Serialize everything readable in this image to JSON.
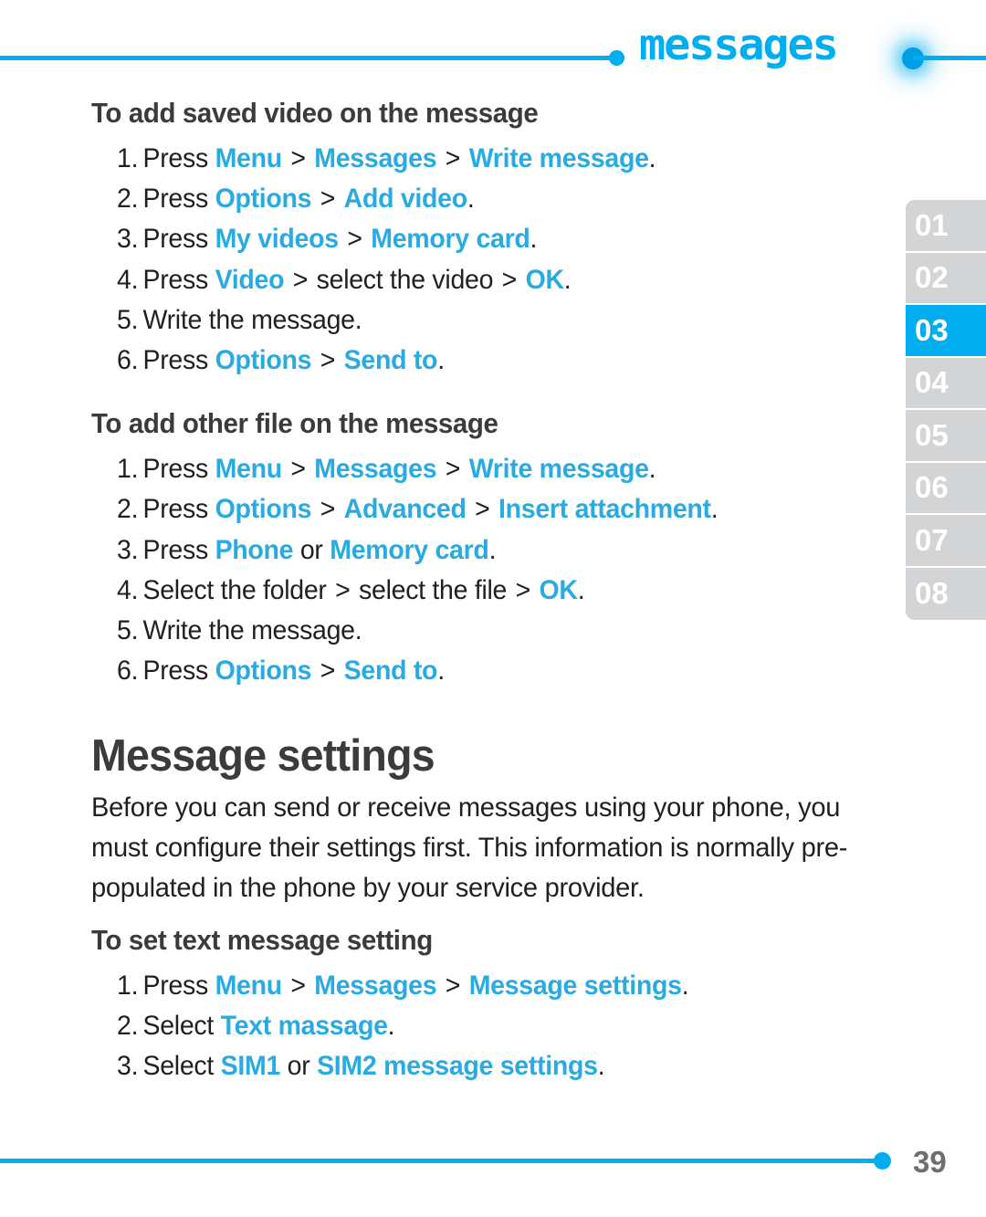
{
  "header": {
    "title": "messages",
    "left_dot": "bullet-dot",
    "right_dot": "bullet-dot-glow",
    "accent_color": "#00AEEF"
  },
  "sidebar": {
    "active_index": 2,
    "active_color": "#00AEEF",
    "inactive_color": "#D2D4D5",
    "tabs": [
      {
        "label": "01"
      },
      {
        "label": "02"
      },
      {
        "label": "03"
      },
      {
        "label": "04"
      },
      {
        "label": "05"
      },
      {
        "label": "06"
      },
      {
        "label": "07"
      },
      {
        "label": "08"
      }
    ]
  },
  "content": {
    "link_color": "#29ABE2",
    "sections": [
      {
        "heading": "To add saved video on the message",
        "steps": [
          {
            "num": "1.",
            "parts": [
              {
                "t": "Press ",
                "k": "plain"
              },
              {
                "t": "Menu",
                "k": "link"
              },
              {
                "t": " > ",
                "k": "sep"
              },
              {
                "t": "Messages",
                "k": "link"
              },
              {
                "t": " > ",
                "k": "sep"
              },
              {
                "t": "Write message",
                "k": "link"
              },
              {
                "t": ".",
                "k": "plain"
              }
            ]
          },
          {
            "num": "2.",
            "parts": [
              {
                "t": "Press ",
                "k": "plain"
              },
              {
                "t": "Options",
                "k": "link"
              },
              {
                "t": " > ",
                "k": "sep"
              },
              {
                "t": "Add video",
                "k": "link"
              },
              {
                "t": ".",
                "k": "plain"
              }
            ]
          },
          {
            "num": "3.",
            "parts": [
              {
                "t": "Press ",
                "k": "plain"
              },
              {
                "t": "My videos",
                "k": "link"
              },
              {
                "t": " > ",
                "k": "sep"
              },
              {
                "t": "Memory card",
                "k": "link"
              },
              {
                "t": ".",
                "k": "plain"
              }
            ]
          },
          {
            "num": "4.",
            "parts": [
              {
                "t": "Press ",
                "k": "plain"
              },
              {
                "t": "Video",
                "k": "link"
              },
              {
                "t": " > ",
                "k": "sep"
              },
              {
                "t": "select the video",
                "k": "plain"
              },
              {
                "t": " > ",
                "k": "sep"
              },
              {
                "t": "OK",
                "k": "link"
              },
              {
                "t": ".",
                "k": "plain"
              }
            ]
          },
          {
            "num": "5.",
            "parts": [
              {
                "t": "Write the message.",
                "k": "plain"
              }
            ]
          },
          {
            "num": "6.",
            "parts": [
              {
                "t": "Press ",
                "k": "plain"
              },
              {
                "t": "Options",
                "k": "link"
              },
              {
                "t": " > ",
                "k": "sep"
              },
              {
                "t": "Send to",
                "k": "link"
              },
              {
                "t": ".",
                "k": "plain"
              }
            ]
          }
        ]
      },
      {
        "heading": "To add other file on the message",
        "steps": [
          {
            "num": "1.",
            "parts": [
              {
                "t": "Press ",
                "k": "plain"
              },
              {
                "t": "Menu",
                "k": "link"
              },
              {
                "t": " > ",
                "k": "sep"
              },
              {
                "t": "Messages",
                "k": "link"
              },
              {
                "t": " > ",
                "k": "sep"
              },
              {
                "t": "Write message",
                "k": "link"
              },
              {
                "t": ".",
                "k": "plain"
              }
            ]
          },
          {
            "num": "2.",
            "parts": [
              {
                "t": "Press ",
                "k": "plain"
              },
              {
                "t": "Options",
                "k": "link"
              },
              {
                "t": " > ",
                "k": "sep"
              },
              {
                "t": "Advanced",
                "k": "link"
              },
              {
                "t": " > ",
                "k": "sep"
              },
              {
                "t": "Insert attachment",
                "k": "link"
              },
              {
                "t": ".",
                "k": "plain"
              }
            ]
          },
          {
            "num": "3.",
            "parts": [
              {
                "t": "Press ",
                "k": "plain"
              },
              {
                "t": "Phone",
                "k": "link"
              },
              {
                "t": " or ",
                "k": "plain"
              },
              {
                "t": "Memory card",
                "k": "link"
              },
              {
                "t": ".",
                "k": "plain"
              }
            ]
          },
          {
            "num": "4.",
            "parts": [
              {
                "t": "Select the folder",
                "k": "plain"
              },
              {
                "t": " > ",
                "k": "sep"
              },
              {
                "t": "select the file",
                "k": "plain"
              },
              {
                "t": " > ",
                "k": "sep"
              },
              {
                "t": "OK",
                "k": "link"
              },
              {
                "t": ".",
                "k": "plain"
              }
            ]
          },
          {
            "num": "5.",
            "parts": [
              {
                "t": "Write the message.",
                "k": "plain"
              }
            ]
          },
          {
            "num": "6.",
            "parts": [
              {
                "t": "Press ",
                "k": "plain"
              },
              {
                "t": "Options",
                "k": "link"
              },
              {
                "t": " > ",
                "k": "sep"
              },
              {
                "t": "Send to",
                "k": "link"
              },
              {
                "t": ".",
                "k": "plain"
              }
            ]
          }
        ]
      }
    ],
    "main_heading": "Message settings",
    "intro_paragraph": "Before you can send or receive messages using your phone, you must configure their settings first. This information is normally pre-populated in the phone by your service provider.",
    "last_section": {
      "heading": "To set text message setting",
      "steps": [
        {
          "num": "1.",
          "parts": [
            {
              "t": "Press ",
              "k": "plain"
            },
            {
              "t": "Menu",
              "k": "link"
            },
            {
              "t": " > ",
              "k": "sep"
            },
            {
              "t": "Messages",
              "k": "link"
            },
            {
              "t": " > ",
              "k": "sep"
            },
            {
              "t": "Message settings",
              "k": "link"
            },
            {
              "t": ".",
              "k": "plain"
            }
          ]
        },
        {
          "num": "2.",
          "parts": [
            {
              "t": "Select ",
              "k": "plain"
            },
            {
              "t": "Text massage",
              "k": "link"
            },
            {
              "t": ".",
              "k": "plain"
            }
          ]
        },
        {
          "num": "3.",
          "parts": [
            {
              "t": "Select ",
              "k": "plain"
            },
            {
              "t": "SIM1",
              "k": "link"
            },
            {
              "t": " or ",
              "k": "plain"
            },
            {
              "t": "SIM2 message settings",
              "k": "link"
            },
            {
              "t": ".",
              "k": "plain"
            }
          ]
        }
      ]
    }
  },
  "footer": {
    "page_number": "39",
    "dot": "bullet-dot"
  }
}
